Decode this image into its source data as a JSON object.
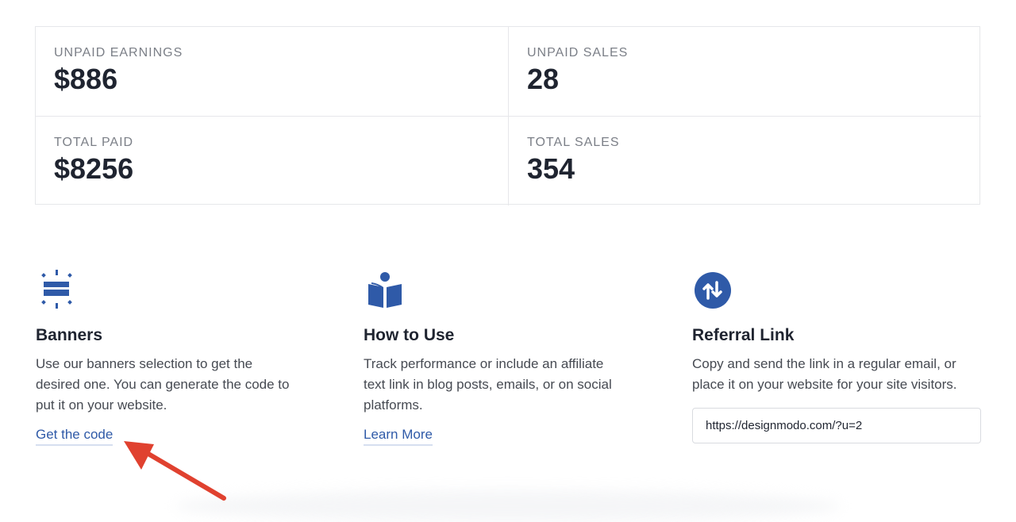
{
  "stats": [
    {
      "label": "UNPAID EARNINGS",
      "value": "$886"
    },
    {
      "label": "UNPAID SALES",
      "value": "28"
    },
    {
      "label": "TOTAL PAID",
      "value": "$8256"
    },
    {
      "label": "TOTAL SALES",
      "value": "354"
    }
  ],
  "features": [
    {
      "icon": "banner-icon",
      "title": "Banners",
      "description": "Use our banners selection to get the desired one. You can generate the code to put it on your website.",
      "link": "Get the code"
    },
    {
      "icon": "book-reader-icon",
      "title": "How to Use",
      "description": "Track performance or include an affiliate text link in blog posts, emails, or on social platforms.",
      "link": "Learn More"
    },
    {
      "icon": "swap-arrows-icon",
      "title": "Referral Link",
      "description": "Copy and send the link in a regular email, or place it on your website for your site visitors.",
      "input_value": "https://designmodo.com/?u=2"
    }
  ],
  "colors": {
    "accent": "#2f5aa8",
    "icon_blue": "#2f5aa8",
    "annotation_arrow": "#e0412f"
  }
}
